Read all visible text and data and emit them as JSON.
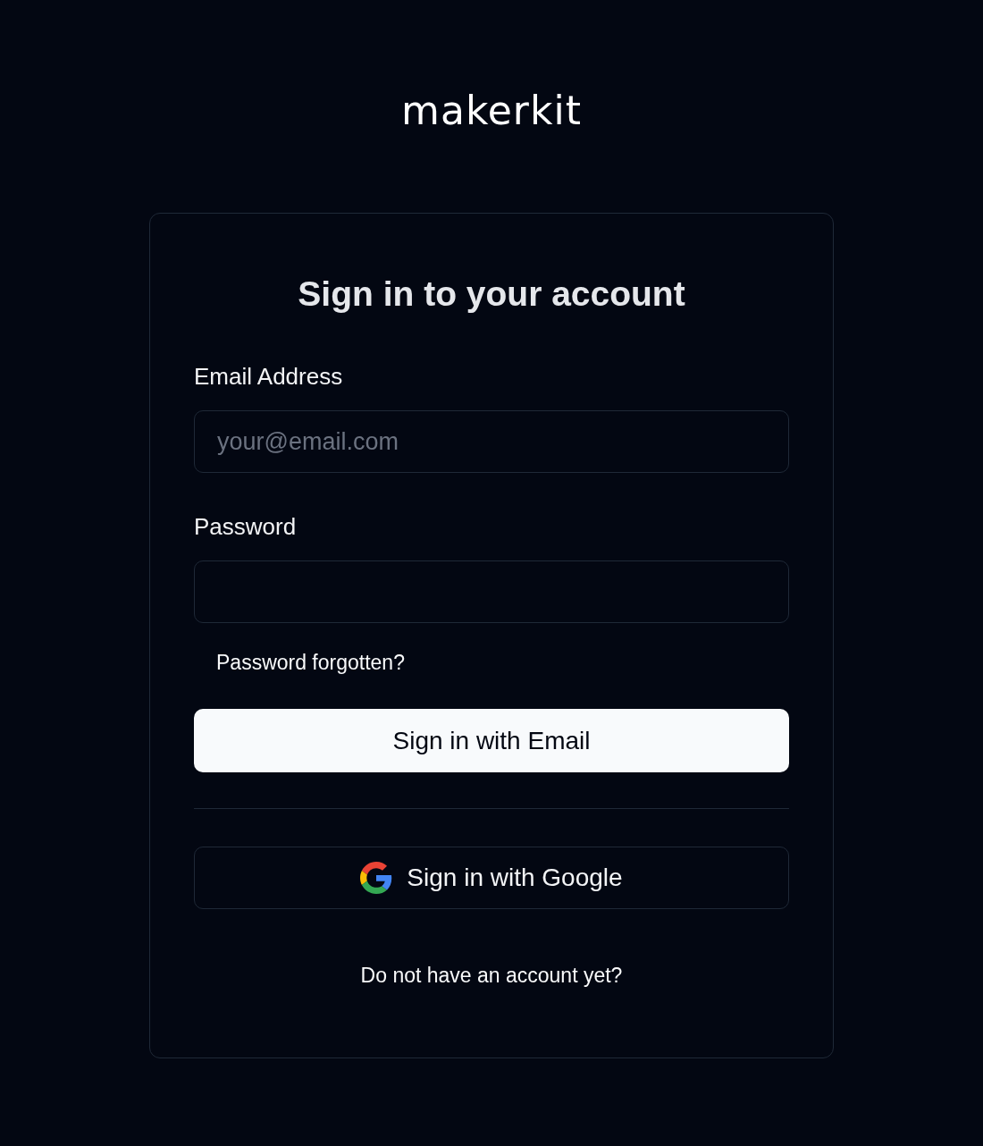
{
  "logo": "makerkit",
  "title": "Sign in to your account",
  "email": {
    "label": "Email Address",
    "placeholder": "your@email.com"
  },
  "password": {
    "label": "Password"
  },
  "forgot_link": "Password forgotten?",
  "email_button": "Sign in with Email",
  "google_button": "Sign in with Google",
  "signup_link": "Do not have an account yet?"
}
